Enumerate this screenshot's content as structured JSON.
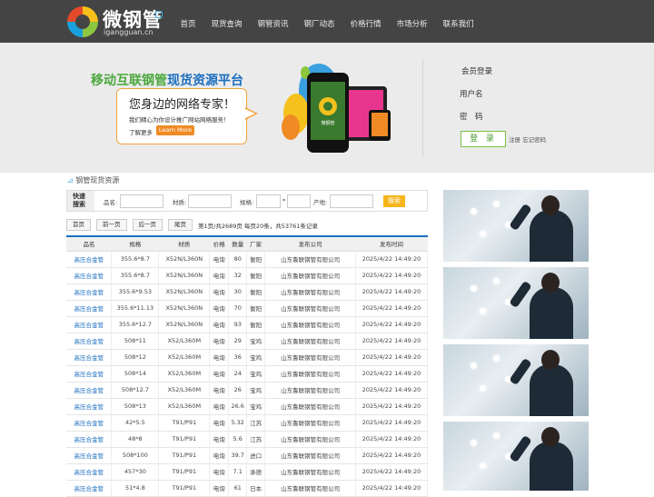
{
  "header": {
    "logo_title": "微钢管",
    "logo_domain": "igangguan.cn",
    "nav": [
      "首页",
      "现货查询",
      "钢管资讯",
      "钢厂动态",
      "价格行情",
      "市场分析",
      "联系我们"
    ]
  },
  "banner": {
    "slogan_left": "移动互联钢管",
    "slogan_right": "现货资源平台",
    "bubble_title": "您身边的网络专家！",
    "bubble_text": "我们精心为你设计推广网站网络服务！",
    "more_text": "了解更多",
    "learn_more": "Learn More",
    "phone_app_label": "微钢管"
  },
  "login": {
    "title": "会员登录",
    "username_label": "用户名",
    "password_label": "密　码",
    "login_button": "登 录",
    "register": "注册",
    "forgot": "忘记密码"
  },
  "section": {
    "title": "钢管现货资源"
  },
  "search": {
    "label_line1": "快速",
    "label_line2": "搜索",
    "name_label": "品名:",
    "material_label": "材质:",
    "spec_label": "规格:",
    "spec_sep": "*",
    "origin_label": "产地:",
    "button": "搜索"
  },
  "pager": {
    "first": "首页",
    "prev": "前一页",
    "next": "后一页",
    "last": "尾页",
    "info": "第1页/共2689页 每页20条，共53761条记录"
  },
  "table": {
    "headers": [
      "品名",
      "规格",
      "材质",
      "价格",
      "数量",
      "厂家",
      "发布公司",
      "发布时间"
    ],
    "rows": [
      [
        "高压合金管",
        "355.6*8.7",
        "X52N/L360N",
        "电询",
        "80",
        "衡阳",
        "山东鲁联钢管有限公司",
        "2025/4/22 14:49:20"
      ],
      [
        "高压合金管",
        "355.6*8.7",
        "X52N/L360N",
        "电询",
        "32",
        "衡阳",
        "山东鲁联钢管有限公司",
        "2025/4/22 14:49:20"
      ],
      [
        "高压合金管",
        "355.6*9.53",
        "X52N/L360N",
        "电询",
        "30",
        "衡阳",
        "山东鲁联钢管有限公司",
        "2025/4/22 14:49:20"
      ],
      [
        "高压合金管",
        "355.6*11.13",
        "X52N/L360N",
        "电询",
        "70",
        "衡阳",
        "山东鲁联钢管有限公司",
        "2025/4/22 14:49:20"
      ],
      [
        "高压合金管",
        "355.6*12.7",
        "X52N/L360N",
        "电询",
        "93",
        "衡阳",
        "山东鲁联钢管有限公司",
        "2025/4/22 14:49:20"
      ],
      [
        "高压合金管",
        "508*11",
        "X52/L360M",
        "电询",
        "29",
        "宝鸡",
        "山东鲁联钢管有限公司",
        "2025/4/22 14:49:20"
      ],
      [
        "高压合金管",
        "508*12",
        "X52/L360M",
        "电询",
        "36",
        "宝鸡",
        "山东鲁联钢管有限公司",
        "2025/4/22 14:49:20"
      ],
      [
        "高压合金管",
        "508*14",
        "X52/L360M",
        "电询",
        "24",
        "宝鸡",
        "山东鲁联钢管有限公司",
        "2025/4/22 14:49:20"
      ],
      [
        "高压合金管",
        "508*12.7",
        "X52/L360M",
        "电询",
        "26",
        "宝鸡",
        "山东鲁联钢管有限公司",
        "2025/4/22 14:49:20"
      ],
      [
        "高压合金管",
        "508*13",
        "X52/L360M",
        "电询",
        "26.6",
        "宝鸡",
        "山东鲁联钢管有限公司",
        "2025/4/22 14:49:20"
      ],
      [
        "高压合金管",
        "42*5.5",
        "T91/P91",
        "电询",
        "5.32",
        "江苏",
        "山东鲁联钢管有限公司",
        "2025/4/22 14:49:20"
      ],
      [
        "高压合金管",
        "48*8",
        "T91/P91",
        "电询",
        "5.6",
        "江苏",
        "山东鲁联钢管有限公司",
        "2025/4/22 14:49:20"
      ],
      [
        "高压合金管",
        "508*100",
        "T91/P91",
        "电询",
        "39.7",
        "进口",
        "山东鲁联钢管有限公司",
        "2025/4/22 14:49:20"
      ],
      [
        "高压合金管",
        "457*30",
        "T91/P91",
        "电询",
        "7.1",
        "承德",
        "山东鲁联钢管有限公司",
        "2025/4/22 14:49:20"
      ],
      [
        "高压合金管",
        "51*4.8",
        "T91/P91",
        "电询",
        "61",
        "日本",
        "山东鲁联钢管有限公司",
        "2025/4/22 14:49:20"
      ]
    ]
  }
}
